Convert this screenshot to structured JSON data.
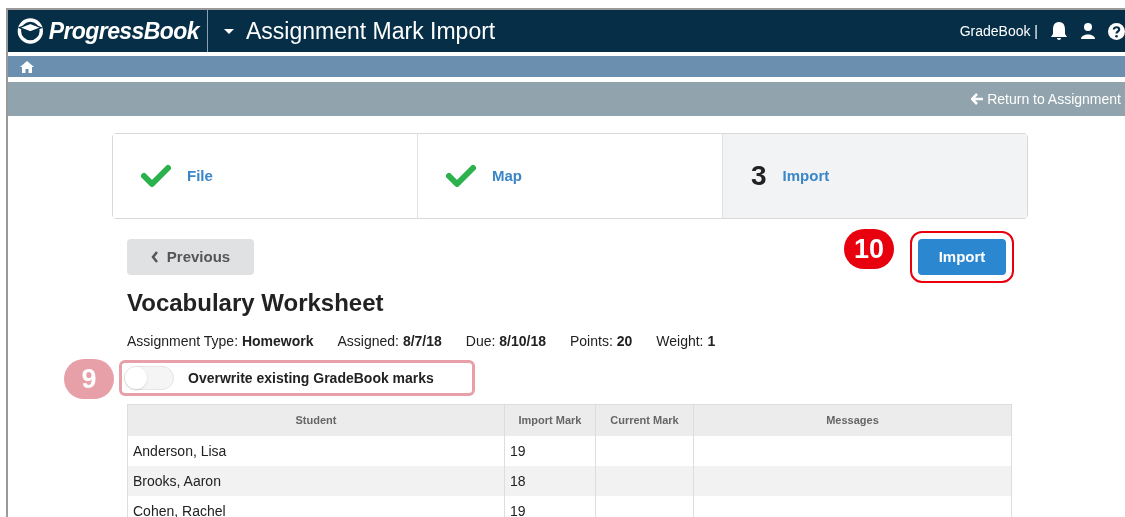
{
  "header": {
    "brand": "ProgressBook",
    "title": "Assignment Mark Import",
    "app": "GradeBook |"
  },
  "subheader": {
    "return_link": "Return to Assignment"
  },
  "steps": [
    {
      "kind": "done",
      "label": "File",
      "selected": false
    },
    {
      "kind": "done",
      "label": "Map",
      "selected": false
    },
    {
      "kind": "number",
      "number": "3",
      "label": "Import",
      "selected": true
    }
  ],
  "previous_button": "Previous",
  "import_button": "Import",
  "assignment": {
    "title": "Vocabulary Worksheet",
    "meta": [
      {
        "label": "Assignment Type:",
        "value": "Homework"
      },
      {
        "label": "Assigned:",
        "value": "8/7/18"
      },
      {
        "label": "Due:",
        "value": "8/10/18"
      },
      {
        "label": "Points:",
        "value": "20"
      },
      {
        "label": "Weight:",
        "value": "1"
      }
    ]
  },
  "overwrite_toggle": {
    "label": "Overwrite existing GradeBook marks",
    "on": false
  },
  "callouts": [
    {
      "number": "9",
      "color": "#e8a0a8"
    },
    {
      "number": "10",
      "color": "#e8000f"
    }
  ],
  "table": {
    "columns": [
      "Student",
      "Import Mark",
      "Current Mark",
      "Messages"
    ],
    "rows": [
      [
        "Anderson, Lisa",
        "19",
        "",
        ""
      ],
      [
        "Brooks, Aaron",
        "18",
        "",
        ""
      ],
      [
        "Cohen, Rachel",
        "19",
        "",
        ""
      ]
    ]
  }
}
